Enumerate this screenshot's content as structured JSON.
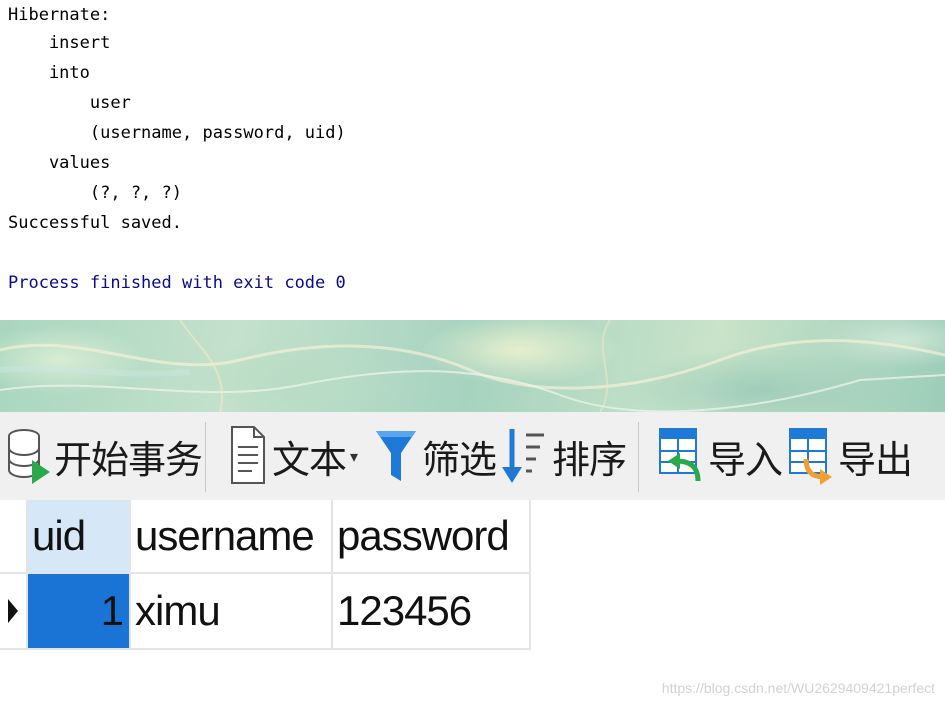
{
  "console": {
    "lines": [
      "Hibernate: ",
      "    insert ",
      "    into",
      "        user",
      "        (username, password, uid) ",
      "    values",
      "        (?, ?, ?)",
      "Successful saved.",
      "",
      "Process finished with exit code 0"
    ],
    "text_color": "#000000",
    "exit_color": "#0b0b8a"
  },
  "toolbar": {
    "begin_transaction": {
      "label": "开始事务",
      "icon": "database-transaction-icon"
    },
    "text": {
      "label": "文本",
      "icon": "document-text-icon",
      "dropdown": "▾"
    },
    "filter": {
      "label": "筛选",
      "icon": "filter-funnel-icon"
    },
    "sort": {
      "label": "排序",
      "icon": "sort-list-icon"
    },
    "import": {
      "label": "导入",
      "icon": "table-import-icon"
    },
    "export": {
      "label": "导出",
      "icon": "table-export-icon"
    },
    "accent_blue": "#1e7ad6",
    "accent_orange": "#f0a030",
    "accent_green": "#2aa84a"
  },
  "grid": {
    "columns": [
      "uid",
      "username",
      "password"
    ],
    "rows": [
      {
        "uid": "1",
        "username": "ximu",
        "password": "123456"
      }
    ],
    "selected_color": "#1a74d6",
    "header_selected_color": "#d6e8f8"
  },
  "watermark": "https://blog.csdn.net/WU2629409421perfect"
}
